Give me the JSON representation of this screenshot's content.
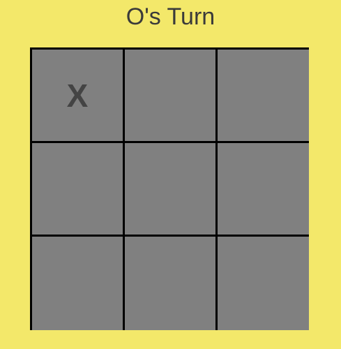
{
  "status": {
    "turn_text": "O's Turn"
  },
  "colors": {
    "background": "#f3e86a",
    "cell": "#808080",
    "grid_line": "#000000",
    "mark": "#444444"
  },
  "board": {
    "cells": [
      "X",
      "",
      "",
      "",
      "",
      "",
      "",
      "",
      ""
    ]
  }
}
